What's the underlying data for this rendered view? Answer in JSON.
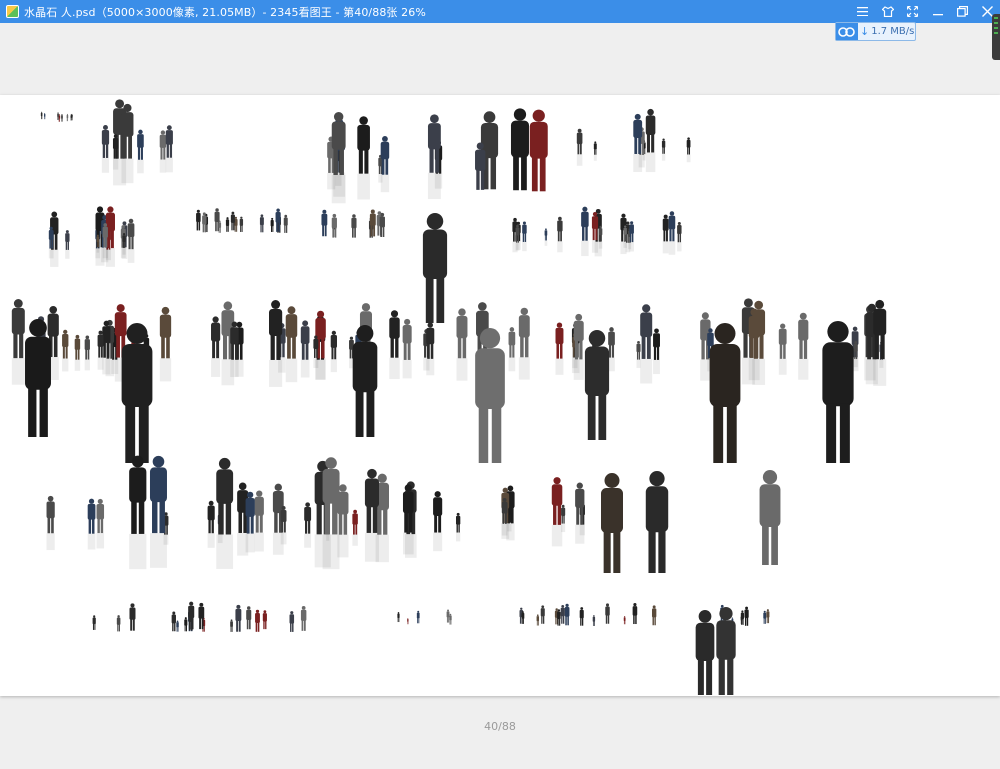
{
  "window": {
    "title": "水晶石 人.psd（5000×3000像素, 21.05MB）- 2345看图王 - 第40/88张 26%"
  },
  "download_widget": {
    "speed": "1.7 MB/s",
    "icon": "cloud-download-icon"
  },
  "title_controls": [
    {
      "name": "menu-icon"
    },
    {
      "name": "skin-icon"
    },
    {
      "name": "fullscreen-icon"
    },
    {
      "name": "minimize-icon"
    },
    {
      "name": "restore-icon"
    },
    {
      "name": "close-icon"
    }
  ],
  "viewer": {
    "page_indicator": "40/88",
    "image_content": "people-cutouts"
  },
  "colors": {
    "titlebar": "#3b8ee8",
    "background": "#efefef",
    "canvas": "#ffffff"
  }
}
